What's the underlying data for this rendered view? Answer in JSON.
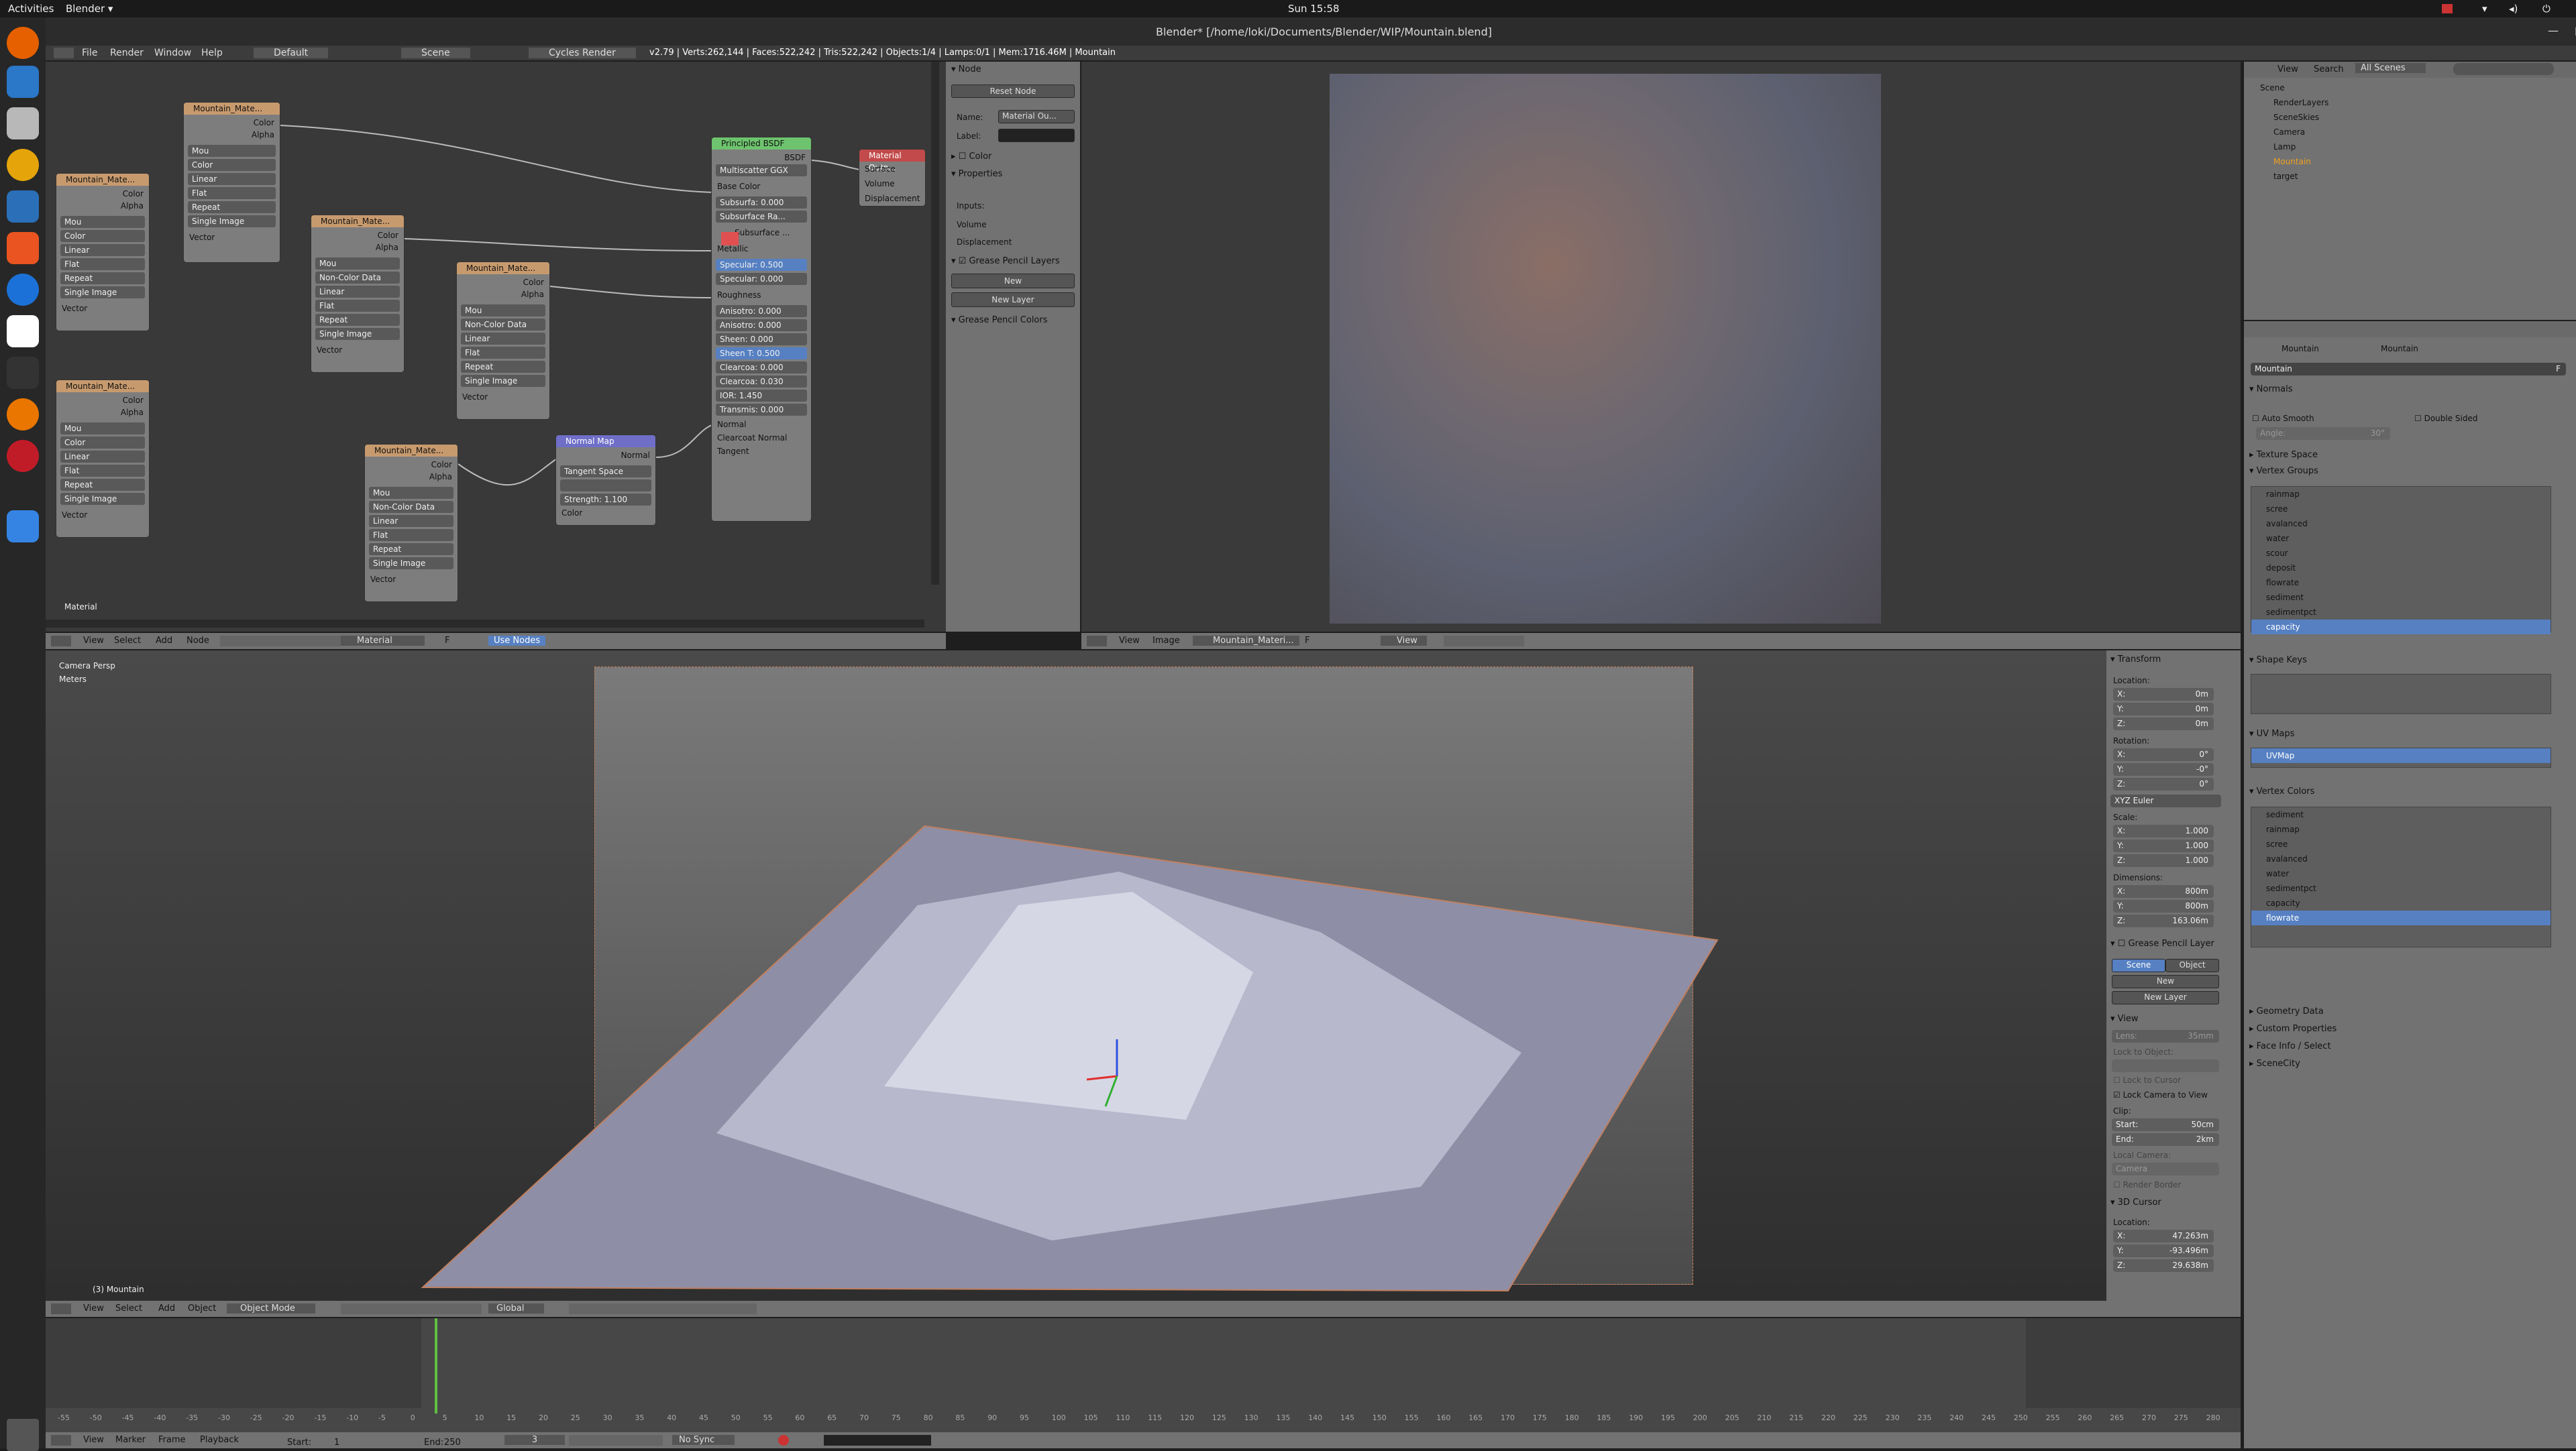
{
  "system": {
    "activities": "Activities",
    "app": "Blender ▾",
    "clock": "Sun 15:58"
  },
  "window": {
    "title": "Blender* [/home/loki/Documents/Blender/WIP/Mountain.blend]"
  },
  "menubar": {
    "file": "File",
    "render": "Render",
    "window": "Window",
    "help": "Help",
    "layout": "Default",
    "scene": "Scene",
    "engine": "Cycles Render",
    "stats": "v2.79 | Verts:262,144 | Faces:522,242 | Tris:522,242 | Objects:1/4 | Lamps:0/1 | Mem:1716.46M | Mountain"
  },
  "nodes": {
    "tex_a": {
      "title": "Mountain_Mate...",
      "color": "Color",
      "alpha": "Alpha",
      "img": "Mou",
      "cs": "Color",
      "interp": "Linear",
      "proj": "Flat",
      "ext": "Repeat",
      "src": "Single Image",
      "vec": "Vector"
    },
    "tex_b": {
      "title": "Mountain_Mate...",
      "color": "Color",
      "alpha": "Alpha",
      "img": "Mou",
      "cs": "Color",
      "interp": "Linear",
      "proj": "Flat",
      "ext": "Repeat",
      "src": "Single Image",
      "vec": "Vector"
    },
    "tex_c": {
      "title": "Mountain_Mate...",
      "color": "Color",
      "alpha": "Alpha",
      "img": "Mou",
      "cs": "Color",
      "interp": "Linear",
      "proj": "Flat",
      "ext": "Repeat",
      "src": "Single Image",
      "vec": "Vector"
    },
    "tex_d": {
      "title": "Mountain_Mate...",
      "color": "Color",
      "alpha": "Alpha",
      "img": "Mou",
      "cs": "Non-Color Data",
      "interp": "Linear",
      "proj": "Flat",
      "ext": "Repeat",
      "src": "Single Image",
      "vec": "Vector"
    },
    "tex_e": {
      "title": "Mountain_Mate...",
      "color": "Color",
      "alpha": "Alpha",
      "img": "Mou",
      "cs": "Non-Color Data",
      "interp": "Linear",
      "proj": "Flat",
      "ext": "Repeat",
      "src": "Single Image",
      "vec": "Vector"
    },
    "tex_f": {
      "title": "Mountain_Mate...",
      "color": "Color",
      "alpha": "Alpha",
      "img": "Mou",
      "cs": "Non-Color Data",
      "interp": "Linear",
      "proj": "Flat",
      "ext": "Repeat",
      "src": "Single Image",
      "vec": "Vector"
    },
    "normal_map": {
      "title": "Normal Map",
      "normal": "Normal",
      "space": "Tangent Space",
      "strength": "Strength: 1.100",
      "color": "Color"
    },
    "bsdf": {
      "title": "Principled BSDF",
      "bsdf": "BSDF",
      "dist": "Multiscatter GGX",
      "base": "Base Color",
      "subsurface": "Subsurfa: 0.000",
      "ss_radius": "Subsurface Ra...",
      "ss_color": "Subsurface ...",
      "metallic": "Metallic",
      "specular": "Specular: 0.500",
      "spec_tint": "Specular: 0.000",
      "roughness": "Roughness",
      "aniso": "Anisotro: 0.000",
      "aniso_rot": "Anisotro: 0.000",
      "sheen": "Sheen: 0.000",
      "sheen_tint": "Sheen T: 0.500",
      "clearcoat": "Clearcoa: 0.000",
      "cc_rough": "Clearcoa: 0.030",
      "ior": "IOR: 1.450",
      "trans": "Transmis: 0.000",
      "normal": "Normal",
      "cc_normal": "Clearcoat Normal",
      "tangent": "Tangent"
    },
    "output": {
      "title": "Material Outp...",
      "surface": "Surface",
      "volume": "Volume",
      "displacement": "Displacement"
    },
    "label": "Material"
  },
  "node_editor_header": {
    "view": "View",
    "select": "Select",
    "add": "Add",
    "node": "Node",
    "material": "Material",
    "f": "F",
    "use_nodes": "Use Nodes"
  },
  "node_props": {
    "node": "Node",
    "reset": "Reset Node",
    "name_l": "Name:",
    "name_v": "Material Ou...",
    "label_l": "Label:",
    "color": "Color",
    "properties": "Properties",
    "inputs": "Inputs:",
    "volume": "Volume",
    "displacement": "Displacement",
    "gp_layers": "Grease Pencil Layers",
    "new": "New",
    "new_layer": "New Layer",
    "gp_colors": "Grease Pencil Colors"
  },
  "image_header": {
    "view": "View",
    "image": "Image",
    "img": "Mountain_Materi...",
    "f": "F",
    "view2": "View"
  },
  "outliner": {
    "view": "View",
    "search": "Search",
    "all": "All Scenes",
    "items": [
      "Scene",
      "RenderLayers",
      "SceneSkies",
      "Camera",
      "Lamp",
      "Mountain",
      "target"
    ]
  },
  "props": {
    "breadcrumb1": "Mountain",
    "breadcrumb2": "Mountain",
    "mesh_name": "Mountain",
    "f": "F",
    "normals": "Normals",
    "auto_smooth": "Auto Smooth",
    "double_sided": "Double Sided",
    "angle": "Angle:",
    "angle_v": "30°",
    "texture_space": "Texture Space",
    "vertex_groups": "Vertex Groups",
    "vgroups": [
      "rainmap",
      "scree",
      "avalanced",
      "water",
      "scour",
      "deposit",
      "flowrate",
      "sediment",
      "sedimentpct",
      "capacity"
    ],
    "shape_keys": "Shape Keys",
    "uv_maps": "UV Maps",
    "uvmap": "UVMap",
    "vertex_colors": "Vertex Colors",
    "vcolors": [
      "sediment",
      "rainmap",
      "scree",
      "avalanced",
      "water",
      "sedimentpct",
      "capacity",
      "flowrate"
    ],
    "geometry": "Geometry Data",
    "custom": "Custom Properties",
    "face_info": "Face Info / Select",
    "scenecity": "SceneCity"
  },
  "viewport": {
    "persp": "Camera Persp",
    "units": "Meters",
    "object": "(3) Mountain"
  },
  "npanel": {
    "transform": "Transform",
    "location": "Location:",
    "lx": "X:",
    "lxv": "0m",
    "ly": "Y:",
    "lyv": "0m",
    "lz": "Z:",
    "lzv": "0m",
    "rotation": "Rotation:",
    "rx": "X:",
    "rxv": "0°",
    "ry": "Y:",
    "ryv": "-0°",
    "rz": "Z:",
    "rzv": "0°",
    "euler": "XYZ Euler",
    "scale": "Scale:",
    "sx": "X:",
    "sxv": "1.000",
    "sy": "Y:",
    "syv": "1.000",
    "sz": "Z:",
    "szv": "1.000",
    "dimensions": "Dimensions:",
    "dx": "X:",
    "dxv": "800m",
    "dy": "Y:",
    "dyv": "800m",
    "dz": "Z:",
    "dzv": "163.06m",
    "gp": "Grease Pencil Layer",
    "scene": "Scene",
    "object": "Object",
    "new": "New",
    "new_layer": "New Layer",
    "view": "View",
    "lens": "Lens:",
    "lens_v": "35mm",
    "lock_obj": "Lock to Object:",
    "lock_cursor": "Lock to Cursor",
    "lock_cam": "Lock Camera to View",
    "clip": "Clip:",
    "start": "Start:",
    "start_v": "50cm",
    "end": "End:",
    "end_v": "2km",
    "local_cam": "Local Camera:",
    "camera": "Camera",
    "render_border": "Render Border",
    "cursor": "3D Cursor",
    "c_loc": "Location:",
    "cx": "X:",
    "cxv": "47.263m",
    "cy": "Y:",
    "cyv": "-93.496m",
    "cz": "Z:",
    "czv": "29.638m"
  },
  "view3d_header": {
    "view": "View",
    "select": "Select",
    "add": "Add",
    "object": "Object",
    "mode": "Object Mode",
    "global": "Global"
  },
  "timeline": {
    "ticks": [
      "-55",
      "-50",
      "-45",
      "-40",
      "-35",
      "-30",
      "-25",
      "-20",
      "-15",
      "-10",
      "-5",
      "0",
      "5",
      "10",
      "15",
      "20",
      "25",
      "30",
      "35",
      "40",
      "45",
      "50",
      "55",
      "60",
      "65",
      "70",
      "75",
      "80",
      "85",
      "90",
      "95",
      "100",
      "105",
      "110",
      "115",
      "120",
      "125",
      "130",
      "135",
      "140",
      "145",
      "150",
      "155",
      "160",
      "165",
      "170",
      "175",
      "180",
      "185",
      "190",
      "195",
      "200",
      "205",
      "210",
      "215",
      "220",
      "225",
      "230",
      "235",
      "240",
      "245",
      "250",
      "255",
      "260",
      "265",
      "270",
      "275",
      "280"
    ],
    "view": "View",
    "marker": "Marker",
    "frame": "Frame",
    "playback": "Playback",
    "start": "Start:",
    "start_v": "1",
    "end": "End:",
    "end_v": "250",
    "current": "3",
    "sync": "No Sync"
  }
}
